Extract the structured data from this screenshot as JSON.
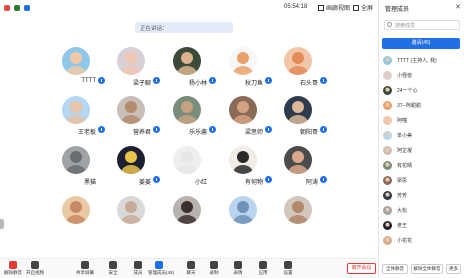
{
  "topbar": {
    "timer": "05:54:18",
    "view_label": "画廊视图",
    "fullscreen_label": "全屏"
  },
  "banner_text": "正在讲话：",
  "tiles": [
    {
      "name": "TTTT",
      "color": "#8fc7e8",
      "skin": "#f1c9a8",
      "mic": true
    },
    {
      "name": "梁子聊",
      "color": "#d8d0d6",
      "skin": "#f0c7b5",
      "mic": true
    },
    {
      "name": "杨小林",
      "color": "#3b4a3a",
      "skin": "#d9b48f",
      "mic": true
    },
    {
      "name": "秋刀鱼",
      "color": "#f7f7f7",
      "skin": "#e9a26b",
      "mic": true
    },
    {
      "name": "石头哥",
      "color": "#f2c6a8",
      "skin": "#e58b5a",
      "mic": true
    },
    {
      "name": "王老板",
      "color": "#b7d7f0",
      "skin": "#e8c4a8",
      "mic": true
    },
    {
      "name": "营养君",
      "color": "#c9bfb8",
      "skin": "#b38b6d",
      "mic": true
    },
    {
      "name": "乐乐酱",
      "color": "#7a8d7a",
      "skin": "#c6a283",
      "mic": true
    },
    {
      "name": "梁思师",
      "color": "#8a6b58",
      "skin": "#d3a27f",
      "mic": true
    },
    {
      "name": "朝阳哥",
      "color": "#2d3b4d",
      "skin": "#dcb79a",
      "mic": true
    },
    {
      "name": "黑猫",
      "color": "#9ea3a6",
      "skin": "#6a6d70",
      "mic": false
    },
    {
      "name": "姜姜",
      "color": "#1c2030",
      "skin": "#e8c34a",
      "mic": true
    },
    {
      "name": "小红",
      "color": "#eeeeee",
      "skin": "#e6e6e6",
      "mic": false
    },
    {
      "name": "有何物",
      "color": "#f0ece6",
      "skin": "#2a2a2a",
      "mic": true
    },
    {
      "name": "阿涛",
      "color": "#4c4c4c",
      "skin": "#d9a98c",
      "mic": true
    },
    {
      "name": "",
      "color": "#e9c9a3",
      "skin": "#c98966",
      "mic": false
    },
    {
      "name": "",
      "color": "#d9d9d9",
      "skin": "#c7ab98",
      "mic": false
    },
    {
      "name": "",
      "color": "#b9b3b0",
      "skin": "#3a3030",
      "mic": false
    },
    {
      "name": "",
      "color": "#b9d4ee",
      "skin": "#6f92b8",
      "mic": false
    },
    {
      "name": "",
      "color": "#d1c7bd",
      "skin": "#b3876a",
      "mic": false
    }
  ],
  "bottombar": {
    "items": [
      {
        "label": "解除静音"
      },
      {
        "label": "开启视频"
      },
      {
        "label": "共享屏幕"
      },
      {
        "label": "安全"
      },
      {
        "label": "成员"
      },
      {
        "label": "管理成员(45)"
      },
      {
        "label": "聊天"
      },
      {
        "label": "录制"
      },
      {
        "label": "表情"
      },
      {
        "label": "应用"
      },
      {
        "label": "设置"
      }
    ],
    "leave_label": "离开会议"
  },
  "panel": {
    "title": "管理成员",
    "close_icon": "close-icon",
    "search_placeholder": "搜索成员",
    "invite_label": "邀请(45)",
    "members": [
      {
        "name": "TTTT",
        "sub": "(主持人, 我)",
        "color": "#8fc7e8"
      },
      {
        "name": "小怪兽",
        "color": "#d8d0d6"
      },
      {
        "name": "24一个心",
        "color": "#3b4a3a"
      },
      {
        "name": "37--阿甜甜",
        "color": "#e9a26b"
      },
      {
        "name": "阿喵",
        "color": "#f2c6a8"
      },
      {
        "name": "单小美",
        "color": "#b7d7f0"
      },
      {
        "name": "阿芷凝",
        "color": "#c9bfb8"
      },
      {
        "name": "有花晴",
        "color": "#7a8d7a"
      },
      {
        "name": "梁思",
        "color": "#8a6b58"
      },
      {
        "name": "芳芳",
        "color": "#2d3b4d"
      },
      {
        "name": "大松",
        "color": "#9ea3a6"
      },
      {
        "name": "老王",
        "color": "#1c2030"
      },
      {
        "name": "小花花",
        "color": "#d9a98c"
      }
    ],
    "footer": {
      "mute_all": "全体静音",
      "unmute_all": "解除全体静音",
      "more": "更多"
    }
  }
}
